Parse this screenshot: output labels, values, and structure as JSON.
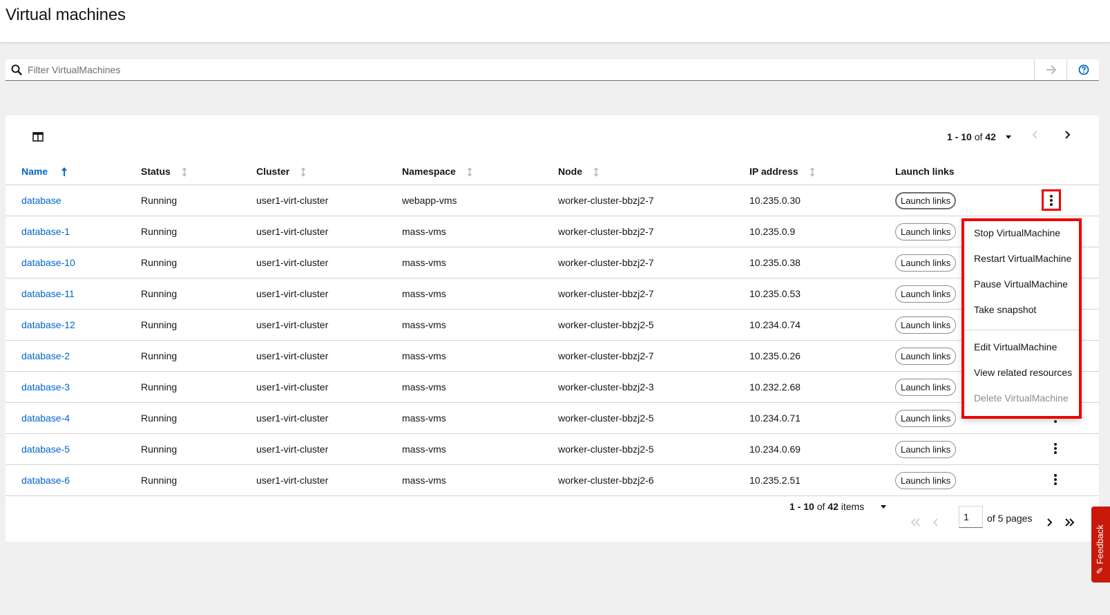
{
  "header": {
    "title": "Virtual machines"
  },
  "filter": {
    "placeholder": "Filter VirtualMachines"
  },
  "pagination_top": {
    "range": "1 - 10",
    "of_label": "of",
    "total": "42"
  },
  "table": {
    "columns": [
      "Name",
      "Status",
      "Cluster",
      "Namespace",
      "Node",
      "IP address",
      "Launch links"
    ],
    "rows": [
      {
        "name": "database",
        "status": "Running",
        "cluster": "user1-virt-cluster",
        "namespace": "webapp-vms",
        "node": "worker-cluster-bbzj2-7",
        "ip": "10.235.0.30",
        "launch": "Launch links"
      },
      {
        "name": "database-1",
        "status": "Running",
        "cluster": "user1-virt-cluster",
        "namespace": "mass-vms",
        "node": "worker-cluster-bbzj2-7",
        "ip": "10.235.0.9",
        "launch": "Launch links"
      },
      {
        "name": "database-10",
        "status": "Running",
        "cluster": "user1-virt-cluster",
        "namespace": "mass-vms",
        "node": "worker-cluster-bbzj2-7",
        "ip": "10.235.0.38",
        "launch": "Launch links"
      },
      {
        "name": "database-11",
        "status": "Running",
        "cluster": "user1-virt-cluster",
        "namespace": "mass-vms",
        "node": "worker-cluster-bbzj2-7",
        "ip": "10.235.0.53",
        "launch": "Launch links"
      },
      {
        "name": "database-12",
        "status": "Running",
        "cluster": "user1-virt-cluster",
        "namespace": "mass-vms",
        "node": "worker-cluster-bbzj2-5",
        "ip": "10.234.0.74",
        "launch": "Launch links"
      },
      {
        "name": "database-2",
        "status": "Running",
        "cluster": "user1-virt-cluster",
        "namespace": "mass-vms",
        "node": "worker-cluster-bbzj2-7",
        "ip": "10.235.0.26",
        "launch": "Launch links"
      },
      {
        "name": "database-3",
        "status": "Running",
        "cluster": "user1-virt-cluster",
        "namespace": "mass-vms",
        "node": "worker-cluster-bbzj2-3",
        "ip": "10.232.2.68",
        "launch": "Launch links"
      },
      {
        "name": "database-4",
        "status": "Running",
        "cluster": "user1-virt-cluster",
        "namespace": "mass-vms",
        "node": "worker-cluster-bbzj2-5",
        "ip": "10.234.0.71",
        "launch": "Launch links"
      },
      {
        "name": "database-5",
        "status": "Running",
        "cluster": "user1-virt-cluster",
        "namespace": "mass-vms",
        "node": "worker-cluster-bbzj2-5",
        "ip": "10.234.0.69",
        "launch": "Launch links"
      },
      {
        "name": "database-6",
        "status": "Running",
        "cluster": "user1-virt-cluster",
        "namespace": "mass-vms",
        "node": "worker-cluster-bbzj2-6",
        "ip": "10.235.2.51",
        "launch": "Launch links"
      }
    ]
  },
  "kebab_menu": {
    "items": [
      "Stop VirtualMachine",
      "Restart VirtualMachine",
      "Pause VirtualMachine",
      "Take snapshot",
      "Edit VirtualMachine",
      "View related resources",
      "Delete VirtualMachine"
    ],
    "disabled_item": "Delete VirtualMachine"
  },
  "pagination_bottom": {
    "range": "1 - 10",
    "of_label": "of",
    "total": "42",
    "items_label": "items",
    "current_page": "1",
    "pages_label": "of 5 pages"
  },
  "feedback": {
    "label": "Feedback"
  },
  "colors": {
    "link": "#0066cc",
    "highlight": "#ee0000",
    "feedback_bg": "#c9190b"
  },
  "icons": [
    "search-icon",
    "arrow-right-icon",
    "help-icon",
    "columns-icon",
    "caret-down-icon",
    "chevron-left-icon",
    "chevron-right-icon",
    "sort-icon",
    "kebab-icon",
    "double-chevron-left-icon",
    "double-chevron-right-icon",
    "feedback-icon"
  ]
}
